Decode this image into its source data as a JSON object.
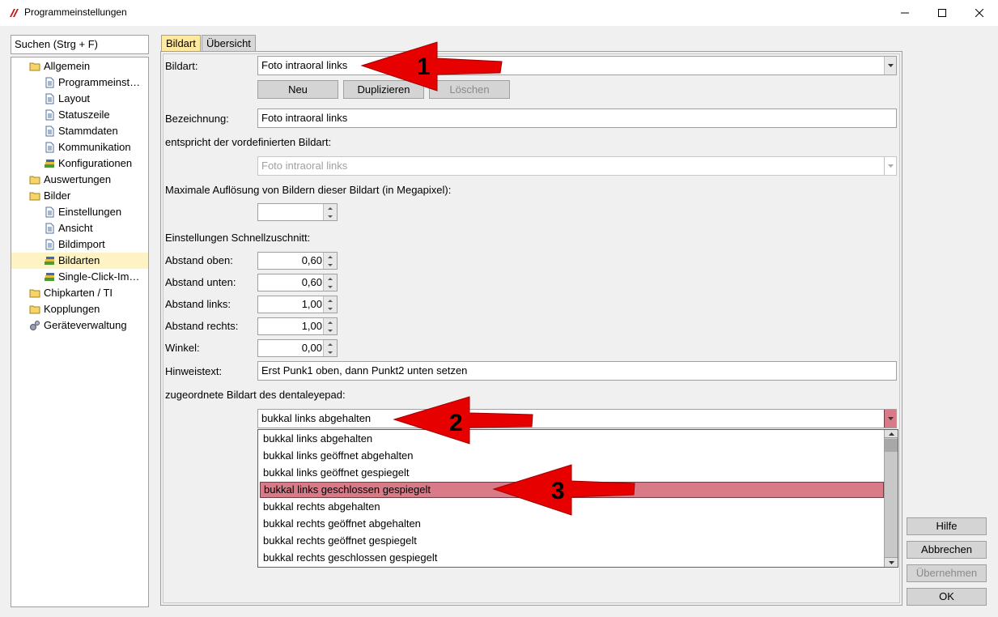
{
  "window": {
    "title": "Programmeinstellungen"
  },
  "search": {
    "placeholder": "Suchen (Strg + F)"
  },
  "tree": [
    {
      "label": "Allgemein",
      "icon": "folder-icon",
      "level": 0
    },
    {
      "label": "Programmeinst…",
      "icon": "page-icon",
      "level": 1
    },
    {
      "label": "Layout",
      "icon": "page-icon",
      "level": 1
    },
    {
      "label": "Statuszeile",
      "icon": "page-icon",
      "level": 1
    },
    {
      "label": "Stammdaten",
      "icon": "page-icon",
      "level": 1
    },
    {
      "label": "Kommunikation",
      "icon": "page-icon",
      "level": 1
    },
    {
      "label": "Konfigurationen",
      "icon": "stack-icon",
      "level": 1
    },
    {
      "label": "Auswertungen",
      "icon": "folder-icon",
      "level": 0
    },
    {
      "label": "Bilder",
      "icon": "folder-icon",
      "level": 0
    },
    {
      "label": "Einstellungen",
      "icon": "page-icon",
      "level": 1
    },
    {
      "label": "Ansicht",
      "icon": "page-icon",
      "level": 1
    },
    {
      "label": "Bildimport",
      "icon": "page-icon",
      "level": 1
    },
    {
      "label": "Bildarten",
      "icon": "stack-icon",
      "level": 1,
      "selected": true
    },
    {
      "label": "Single-Click-Im…",
      "icon": "stack-icon",
      "level": 1
    },
    {
      "label": "Chipkarten / TI",
      "icon": "folder-icon",
      "level": 0
    },
    {
      "label": "Kopplungen",
      "icon": "folder-icon",
      "level": 0
    },
    {
      "label": "Geräteverwaltung",
      "icon": "gears-icon",
      "level": 0
    }
  ],
  "tabs": {
    "bildart": "Bildart",
    "uebersicht": "Übersicht"
  },
  "form": {
    "bildart_label": "Bildart:",
    "bildart_value": "Foto intraoral links",
    "btn_neu": "Neu",
    "btn_duplizieren": "Duplizieren",
    "btn_loeschen": "Löschen",
    "bezeichnung_label": "Bezeichnung:",
    "bezeichnung_value": "Foto intraoral links",
    "vordef_label": "entspricht der vordefinierten Bildart:",
    "vordef_value": "Foto intraoral links",
    "aufloesung_label": "Maximale Auflösung von Bildern dieser Bildart (in Megapixel):",
    "aufloesung_value": "",
    "schnell_label": "Einstellungen Schnellzuschnitt:",
    "abstand_oben_label": "Abstand oben:",
    "abstand_oben_value": "0,60",
    "abstand_unten_label": "Abstand unten:",
    "abstand_unten_value": "0,60",
    "abstand_links_label": "Abstand links:",
    "abstand_links_value": "1,00",
    "abstand_rechts_label": "Abstand rechts:",
    "abstand_rechts_value": "1,00",
    "winkel_label": "Winkel:",
    "winkel_value": "0,00",
    "hinweis_label": "Hinweistext:",
    "hinweis_value": "Erst Punk1 oben, dann Punkt2 unten setzen",
    "dentaleyepad_label": "zugeordnete Bildart des dentaleyepad:",
    "dentaleyepad_value": "bukkal links abgehalten"
  },
  "dropdown_options": [
    "bukkal links abgehalten",
    "bukkal links geöffnet abgehalten",
    "bukkal links geöffnet gespiegelt",
    "bukkal links geschlossen gespiegelt",
    "bukkal rechts abgehalten",
    "bukkal rechts geöffnet abgehalten",
    "bukkal rechts geöffnet gespiegelt",
    "bukkal rechts geschlossen gespiegelt"
  ],
  "dropdown_selected": "bukkal links geschlossen gespiegelt",
  "side_buttons": {
    "hilfe": "Hilfe",
    "abbrechen": "Abbrechen",
    "uebernehmen": "Übernehmen",
    "ok": "OK"
  },
  "annotations": [
    "1",
    "2",
    "3"
  ],
  "colors": {
    "arrow": "#e60000",
    "selection": "#d97a88",
    "tab_active": "#ffe8a0",
    "tree_selected": "#fdf3c5"
  }
}
